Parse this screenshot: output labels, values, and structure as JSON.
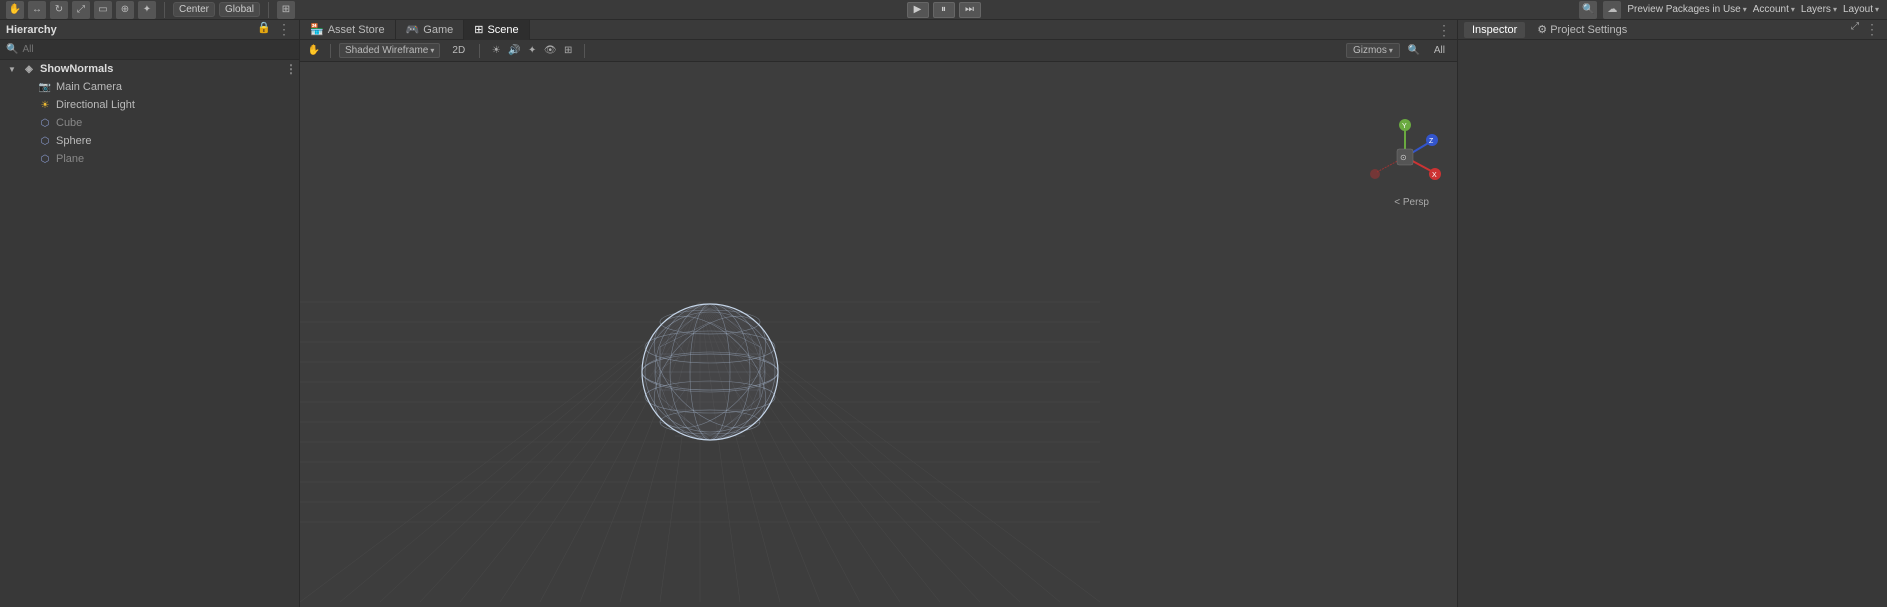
{
  "topbar": {
    "play_btn": "▶",
    "pause_btn": "⏸",
    "step_btn": "⏭",
    "center_toggle": "Center",
    "global_toggle": "Global",
    "preview_packages": "Preview Packages in Use",
    "account": "Account",
    "layers": "Layers",
    "layout": "Layout"
  },
  "hierarchy": {
    "title": "Hierarchy",
    "search_placeholder": "All",
    "items": [
      {
        "label": "ShowNormals",
        "level": "root",
        "icon": "scene",
        "expanded": true
      },
      {
        "label": "Main Camera",
        "level": "child",
        "icon": "camera"
      },
      {
        "label": "Directional Light",
        "level": "child",
        "icon": "light"
      },
      {
        "label": "Cube",
        "level": "child",
        "icon": "cube"
      },
      {
        "label": "Sphere",
        "level": "child",
        "icon": "sphere"
      },
      {
        "label": "Plane",
        "level": "child",
        "icon": "plane"
      }
    ]
  },
  "scene_tabs": [
    {
      "label": "Asset Store",
      "icon": "🏪",
      "active": false
    },
    {
      "label": "Game",
      "icon": "🎮",
      "active": false
    },
    {
      "label": "Scene",
      "icon": "⊞",
      "active": true
    }
  ],
  "scene_toolbar": {
    "shading_mode": "Shaded Wireframe",
    "mode_2d": "2D",
    "gizmos": "Gizmos",
    "all_filter": "All"
  },
  "right_panel": {
    "tabs": [
      {
        "label": "Inspector",
        "active": true
      },
      {
        "label": "Project Settings",
        "active": false
      }
    ]
  },
  "gizmo": {
    "persp_label": "< Persp"
  }
}
